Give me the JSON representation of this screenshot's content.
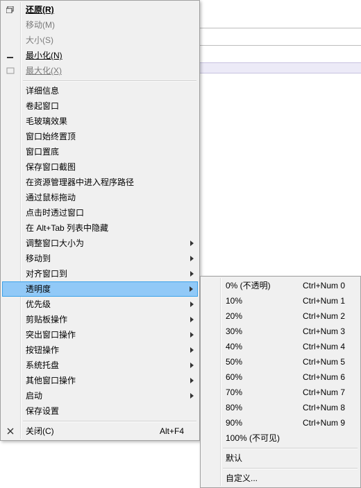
{
  "main_menu": {
    "sections": [
      [
        {
          "icon": "restore-icon",
          "label": "还原(R)",
          "bold": true,
          "underline": true,
          "disabled": false
        },
        {
          "icon": null,
          "label": "移动(M)",
          "disabled": true
        },
        {
          "icon": null,
          "label": "大小(S)",
          "disabled": true
        },
        {
          "icon": "minimize-icon",
          "label": "最小化(N)",
          "underline": true
        },
        {
          "icon": "maximize-icon",
          "label": "最大化(X)",
          "underline": true,
          "disabled": true
        }
      ],
      [
        {
          "label": "详细信息"
        },
        {
          "label": "卷起窗口"
        },
        {
          "label": "毛玻璃效果"
        },
        {
          "label": "窗口始终置顶"
        },
        {
          "label": "窗口置底"
        },
        {
          "label": "保存窗口截图"
        },
        {
          "label": "在资源管理器中进入程序路径"
        },
        {
          "label": "通过鼠标拖动"
        },
        {
          "label": "点击时透过窗口"
        },
        {
          "label": "在 Alt+Tab 列表中隐藏"
        },
        {
          "label": "调整窗口大小为",
          "submenu": true
        },
        {
          "label": "移动到",
          "submenu": true
        },
        {
          "label": "对齐窗口到",
          "submenu": true
        },
        {
          "label": "透明度",
          "submenu": true,
          "selected": true
        },
        {
          "label": "优先级",
          "submenu": true
        },
        {
          "label": "剪贴板操作",
          "submenu": true
        },
        {
          "label": "突出窗口操作",
          "submenu": true
        },
        {
          "label": "按钮操作",
          "submenu": true
        },
        {
          "label": "系统托盘",
          "submenu": true
        },
        {
          "label": "其他窗口操作",
          "submenu": true
        },
        {
          "label": "启动",
          "submenu": true
        },
        {
          "label": "保存设置"
        }
      ],
      [
        {
          "icon": "close-icon",
          "label": "关闭(C)",
          "accel": "Alt+F4"
        }
      ]
    ]
  },
  "sub_menu": {
    "sections": [
      [
        {
          "label": "0% (不透明)",
          "accel": "Ctrl+Num 0"
        },
        {
          "label": "10%",
          "accel": "Ctrl+Num 1"
        },
        {
          "label": "20%",
          "accel": "Ctrl+Num 2"
        },
        {
          "label": "30%",
          "accel": "Ctrl+Num 3"
        },
        {
          "label": "40%",
          "accel": "Ctrl+Num 4"
        },
        {
          "label": "50%",
          "accel": "Ctrl+Num 5"
        },
        {
          "label": "60%",
          "accel": "Ctrl+Num 6"
        },
        {
          "label": "70%",
          "accel": "Ctrl+Num 7"
        },
        {
          "label": "80%",
          "accel": "Ctrl+Num 8"
        },
        {
          "label": "90%",
          "accel": "Ctrl+Num 9"
        },
        {
          "label": "100% (不可见)"
        }
      ],
      [
        {
          "label": "默认"
        }
      ],
      [
        {
          "label": "自定义..."
        }
      ]
    ]
  }
}
